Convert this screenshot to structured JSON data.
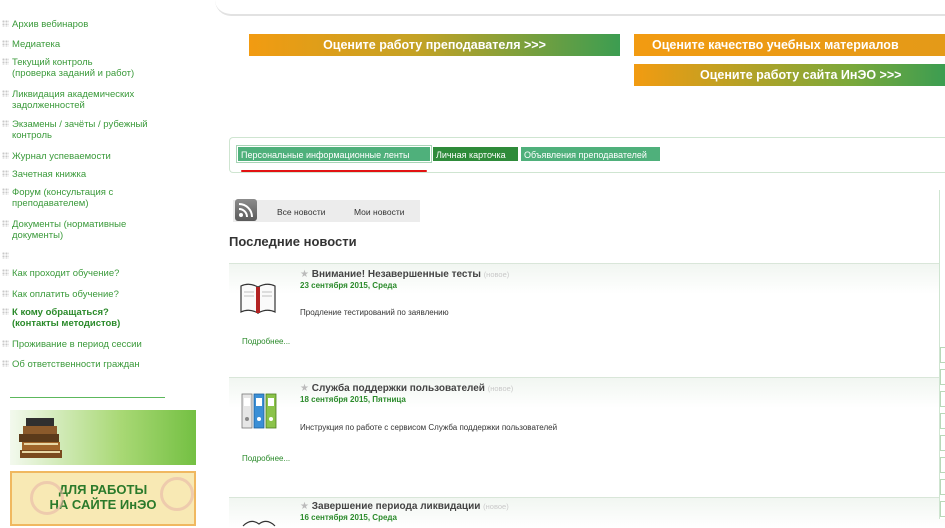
{
  "sidebar": {
    "items": [
      {
        "label": "Архив вебинаров",
        "bold": false
      },
      {
        "label": "Медиатека",
        "bold": false
      },
      {
        "label": "Текущий контроль\n(проверка заданий и работ)",
        "bold": false
      },
      {
        "label": "Ликвидация академических\nзадолженностей",
        "bold": false
      },
      {
        "label": "Экзамены / зачёты / рубежный\nконтроль",
        "bold": false
      },
      {
        "label": "Журнал успеваемости",
        "bold": false
      },
      {
        "label": "Зачетная книжка",
        "bold": false
      },
      {
        "label": "Форум (консультация с\nпреподавателем)",
        "bold": false
      },
      {
        "label": "Документы (нормативные\nдокументы)",
        "bold": false
      },
      {
        "label": "",
        "bold": false
      },
      {
        "label": "Как проходит обучение?",
        "bold": false
      },
      {
        "label": "Как оплатить обучение?",
        "bold": false
      },
      {
        "label": "К кому обращаться?\n(контакты методистов)",
        "bold": true
      },
      {
        "label": "Проживание в период сессии",
        "bold": false
      },
      {
        "label": "Об ответственности граждан",
        "bold": false
      }
    ],
    "promo_browser": {
      "line1": "ДЛЯ РАБОТЫ",
      "line2": "НА САЙТЕ ИнЭО"
    }
  },
  "rating_buttons": {
    "teacher": "Оцените работу преподавателя >>>",
    "materials": "Оцените качество учебных материалов",
    "site": "Оцените работу сайта ИнЭО >>>"
  },
  "tabs": {
    "personal": "Персональные информационные ленты",
    "card": "Личная карточка",
    "ads": "Объявления преподавателей"
  },
  "news": {
    "tab_all": "Все новости",
    "tab_mine": "Мои новости",
    "heading": "Последние новости",
    "items": [
      {
        "title": "Внимание! Незавершенные тесты",
        "badge": "(новое)",
        "date": "23 сентября 2015, Среда",
        "text": "Продление тестирований по заявлению",
        "more": "Подробнее..."
      },
      {
        "title": "Служба поддержки пользователей",
        "badge": "(новое)",
        "date": "18 сентября 2015, Пятница",
        "text": "Инструкция по работе с сервисом Служба поддержки пользователей",
        "more": "Подробнее..."
      },
      {
        "title": "Завершение периода ликвидации",
        "badge": "(новое)",
        "date": "16 сентября 2015, Среда",
        "text": "",
        "more": ""
      }
    ]
  },
  "colors": {
    "accent_green": "#2a8a2a",
    "orange": "#f29b11",
    "underline_red": "#e21212"
  }
}
